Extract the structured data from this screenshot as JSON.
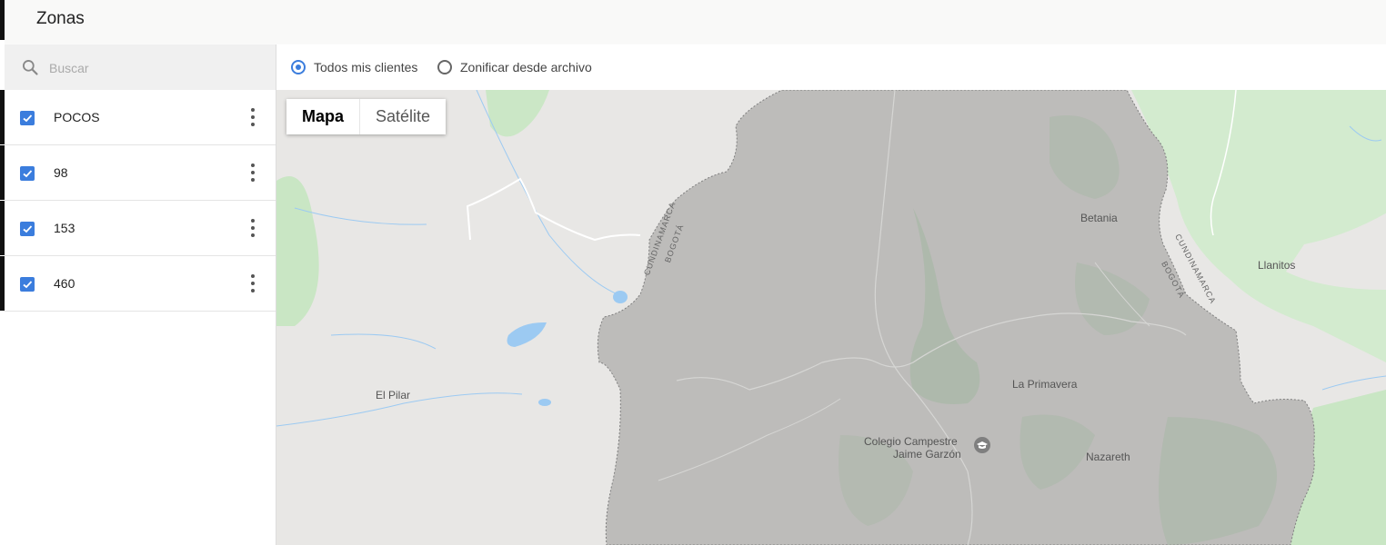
{
  "header": {
    "title": "Zonas"
  },
  "search": {
    "placeholder": "Buscar",
    "icon": "search-icon"
  },
  "zones": [
    {
      "label": "POCOS",
      "checked": true
    },
    {
      "label": "98",
      "checked": true
    },
    {
      "label": "153",
      "checked": true
    },
    {
      "label": "460",
      "checked": true
    }
  ],
  "options": [
    {
      "label": "Todos mis clientes",
      "selected": true
    },
    {
      "label": "Zonificar desde archivo",
      "selected": false
    }
  ],
  "map": {
    "type_buttons": {
      "map": "Mapa",
      "satellite": "Satélite",
      "active": "Mapa"
    },
    "places": {
      "betania": "Betania",
      "llanitos": "Llanitos",
      "el_pilar": "El Pilar",
      "la_primavera": "La Primavera",
      "nazareth": "Nazareth",
      "colegio_line1": "Colegio Campestre",
      "colegio_line2": "Jaime Garzón"
    },
    "boundary_labels": {
      "cundinamarca_left": "CUNDINAMARCA",
      "bogota_left": "BOGOTÁ",
      "cundinamarca_right": "CUNDINAMARCA",
      "bogota_right": "BOGOTÁ"
    },
    "colors": {
      "zone_fill": "#bdbcba",
      "land": "#e8e7e5",
      "park": "#c8e5c4",
      "water": "#9ccaf2"
    }
  }
}
